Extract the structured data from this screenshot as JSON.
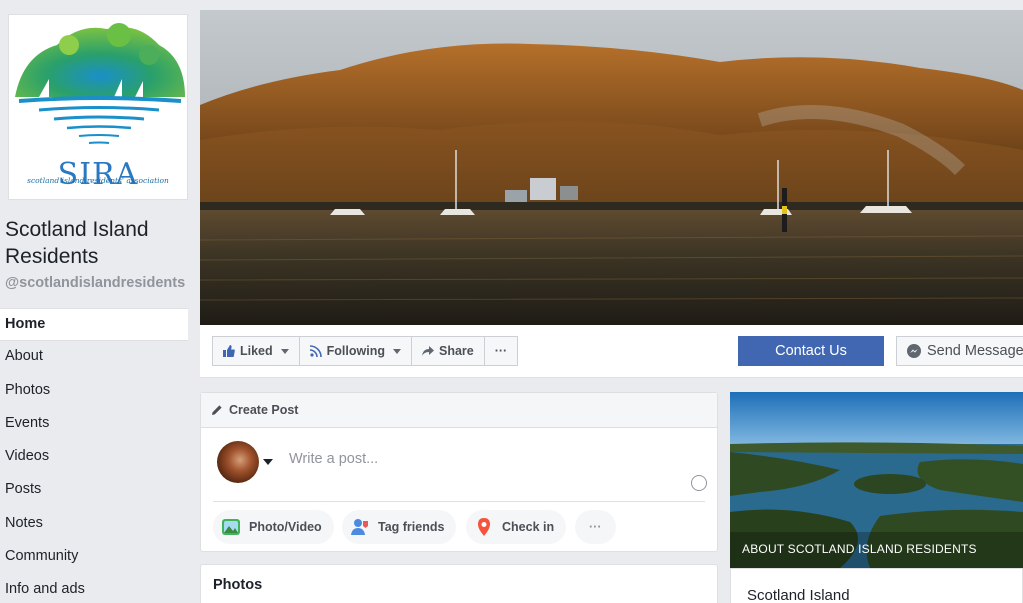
{
  "page": {
    "name": "Scotland Island Residents",
    "handle": "@scotlandislandresidents"
  },
  "logo": {
    "text": "SIRA",
    "caption": "scotland island residents' association"
  },
  "nav": {
    "items": [
      {
        "label": "Home",
        "active": true
      },
      {
        "label": "About"
      },
      {
        "label": "Photos"
      },
      {
        "label": "Events"
      },
      {
        "label": "Videos"
      },
      {
        "label": "Posts"
      },
      {
        "label": "Notes"
      },
      {
        "label": "Community"
      },
      {
        "label": "Info and ads"
      }
    ]
  },
  "actions": {
    "liked": "Liked",
    "following": "Following",
    "share": "Share",
    "more": "···",
    "contact": "Contact Us",
    "send_message": "Send Message"
  },
  "create_post": {
    "title": "Create Post",
    "placeholder": "Write a post...",
    "photo_video": "Photo/Video",
    "tag_friends": "Tag friends",
    "check_in": "Check in",
    "more": "···"
  },
  "photos": {
    "title": "Photos"
  },
  "about": {
    "label": "ABOUT SCOTLAND ISLAND RESIDENTS",
    "subtitle": "Scotland Island"
  },
  "colors": {
    "brand_blue": "#4267b2",
    "background": "#e9ebee"
  }
}
